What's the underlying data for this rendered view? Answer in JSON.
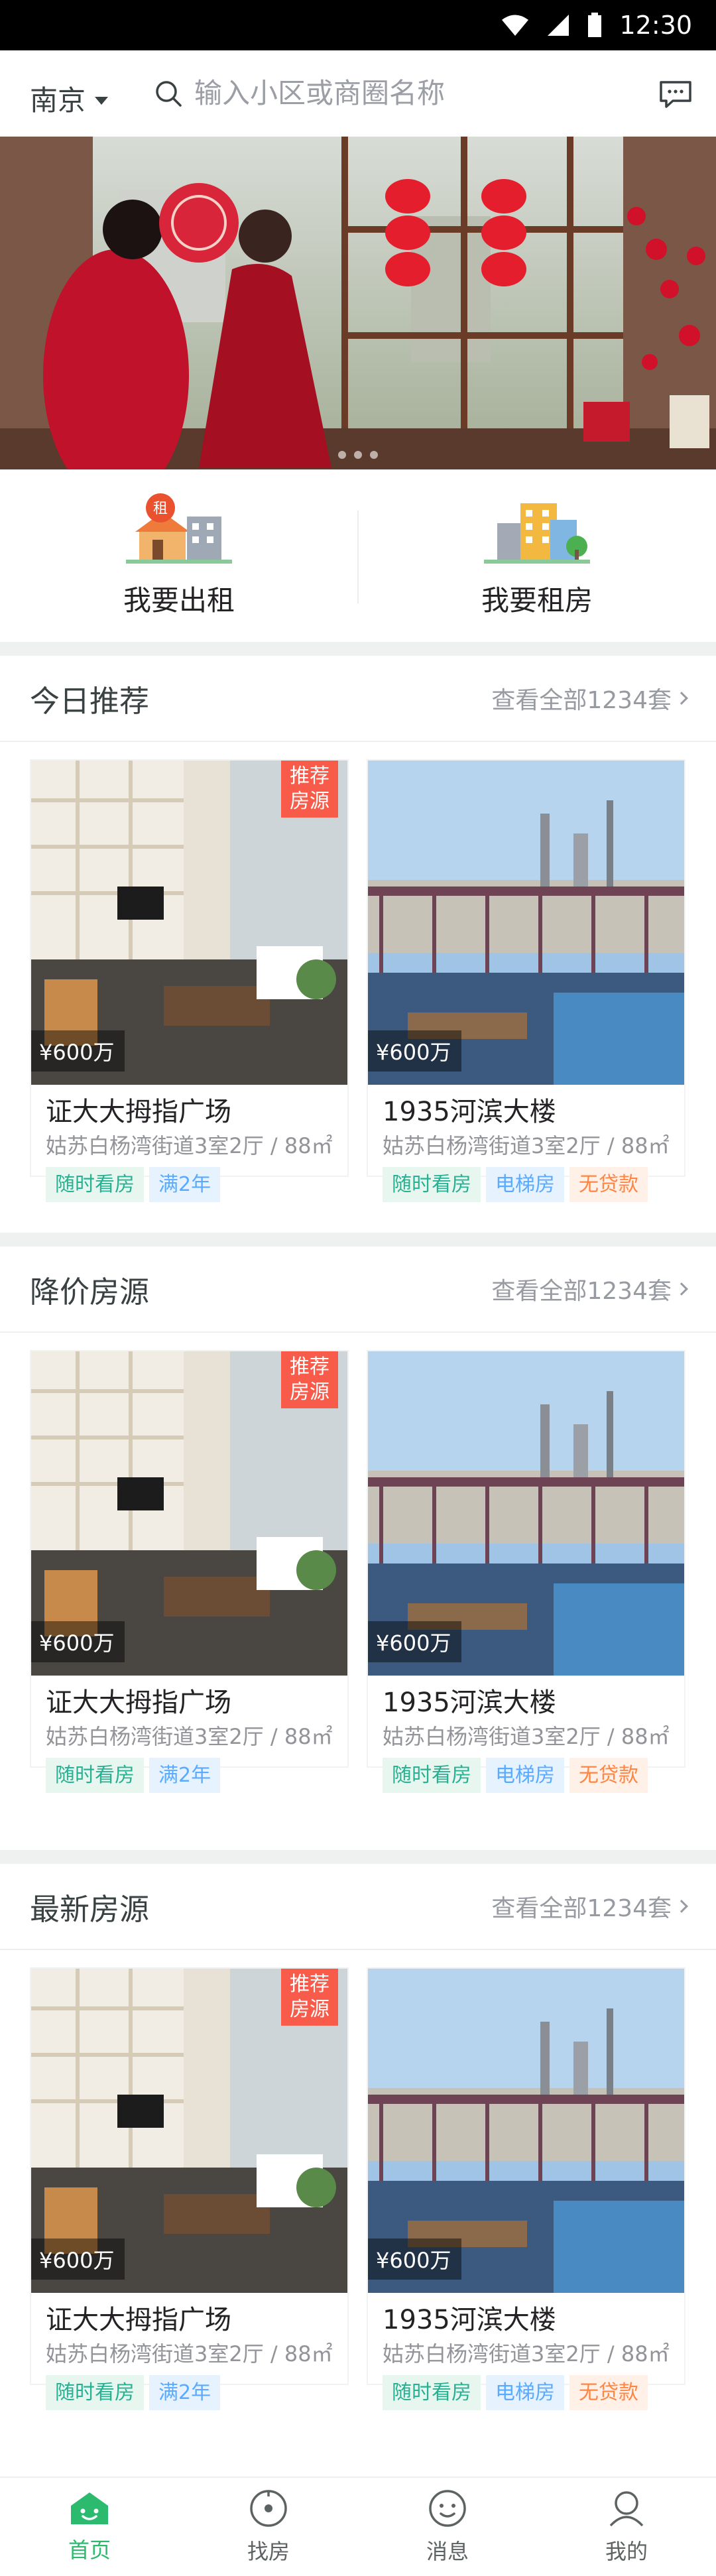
{
  "status": {
    "time": "12:30"
  },
  "header": {
    "city": "南京",
    "search_placeholder": "输入小区或商圈名称"
  },
  "quick_actions": [
    {
      "label": "我要出租",
      "icon": "rent-out-icon",
      "badge": "租"
    },
    {
      "label": "我要租房",
      "icon": "rent-house-icon"
    }
  ],
  "sections": [
    {
      "title": "今日推荐",
      "more": "查看全部1234套",
      "cards": [
        {
          "title": "证大大拇指广场",
          "sub": "姑苏白杨湾街道3室2厅 / 88㎡",
          "price": "¥600万",
          "badge": "推荐房源",
          "tags": [
            {
              "text": "随时看房",
              "color": "green"
            },
            {
              "text": "满2年",
              "color": "blue"
            }
          ]
        },
        {
          "title": "1935河滨大楼",
          "sub": "姑苏白杨湾街道3室2厅 / 88㎡",
          "price": "¥600万",
          "tags": [
            {
              "text": "随时看房",
              "color": "green"
            },
            {
              "text": "电梯房",
              "color": "blue"
            },
            {
              "text": "无贷款",
              "color": "orange"
            }
          ]
        }
      ]
    },
    {
      "title": "降价房源",
      "more": "查看全部1234套",
      "cards": [
        {
          "title": "证大大拇指广场",
          "sub": "姑苏白杨湾街道3室2厅 / 88㎡",
          "price": "¥600万",
          "badge": "推荐房源",
          "tags": [
            {
              "text": "随时看房",
              "color": "green"
            },
            {
              "text": "满2年",
              "color": "blue"
            }
          ]
        },
        {
          "title": "1935河滨大楼",
          "sub": "姑苏白杨湾街道3室2厅 / 88㎡",
          "price": "¥600万",
          "tags": [
            {
              "text": "随时看房",
              "color": "green"
            },
            {
              "text": "电梯房",
              "color": "blue"
            },
            {
              "text": "无贷款",
              "color": "orange"
            }
          ]
        }
      ]
    },
    {
      "title": "最新房源",
      "more": "查看全部1234套",
      "cards": [
        {
          "title": "证大大拇指广场",
          "sub": "姑苏白杨湾街道3室2厅 / 88㎡",
          "price": "¥600万",
          "badge": "推荐房源",
          "tags": [
            {
              "text": "随时看房",
              "color": "green"
            },
            {
              "text": "满2年",
              "color": "blue"
            }
          ]
        },
        {
          "title": "1935河滨大楼",
          "sub": "姑苏白杨湾街道3室2厅 / 88㎡",
          "price": "¥600万",
          "tags": [
            {
              "text": "随时看房",
              "color": "green"
            },
            {
              "text": "电梯房",
              "color": "blue"
            },
            {
              "text": "无贷款",
              "color": "orange"
            }
          ]
        }
      ]
    }
  ],
  "tabbar": [
    {
      "label": "首页",
      "icon": "home-icon",
      "active": true
    },
    {
      "label": "找房",
      "icon": "find-house-icon",
      "active": false
    },
    {
      "label": "消息",
      "icon": "message-icon",
      "active": false
    },
    {
      "label": "我的",
      "icon": "profile-icon",
      "active": false
    }
  ],
  "colors": {
    "accent": "#2CBB6E",
    "badge": "#F95B4A",
    "title": "#394142",
    "subtitle": "#939499",
    "more": "#979AA1"
  }
}
